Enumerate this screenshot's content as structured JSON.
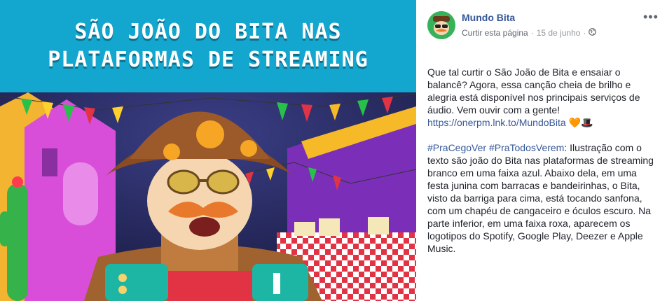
{
  "banner": {
    "line1": "SÃO JOÃO DO BITA NAS",
    "line2": "PLATAFORMAS DE STREAMING"
  },
  "post": {
    "page_name": "Mundo Bita",
    "like_link": "Curtir esta página",
    "separator": "·",
    "date": "15 de junho",
    "separator2": "·",
    "privacy_icon": "globe-icon",
    "more_icon": "more-options-icon",
    "more_glyph": "•••",
    "paragraph1_text": "Que tal curtir o São João de Bita e ensaiar o balancê? Agora, essa canção cheia de brilho e alegria está disponível nos principais serviços de áudio. Vem ouvir com a gente!",
    "paragraph1_link": "https://onerpm.lnk.to/MundoBita",
    "paragraph1_emojis": "🧡🎩",
    "hashtag1": "#PraCegoVer",
    "hashtag2": "#PraTodosVerem",
    "paragraph2_text": ": Ilustração com o texto são joão do Bita nas plataformas de streaming branco em uma faixa azul. Abaixo dela, em uma festa junina com barracas e bandeirinhas, o Bita, visto da barriga para cima, está tocando sanfona, com um chapéu de cangaceiro e óculos escuro. Na parte inferior, em uma faixa roxa, aparecem os logotipos do Spotify, Google Play, Deezer e Apple Music."
  },
  "colors": {
    "banner_blue": "#13a7cf",
    "link_blue": "#365899",
    "text": "#1d2129",
    "meta_gray": "#90949c"
  }
}
